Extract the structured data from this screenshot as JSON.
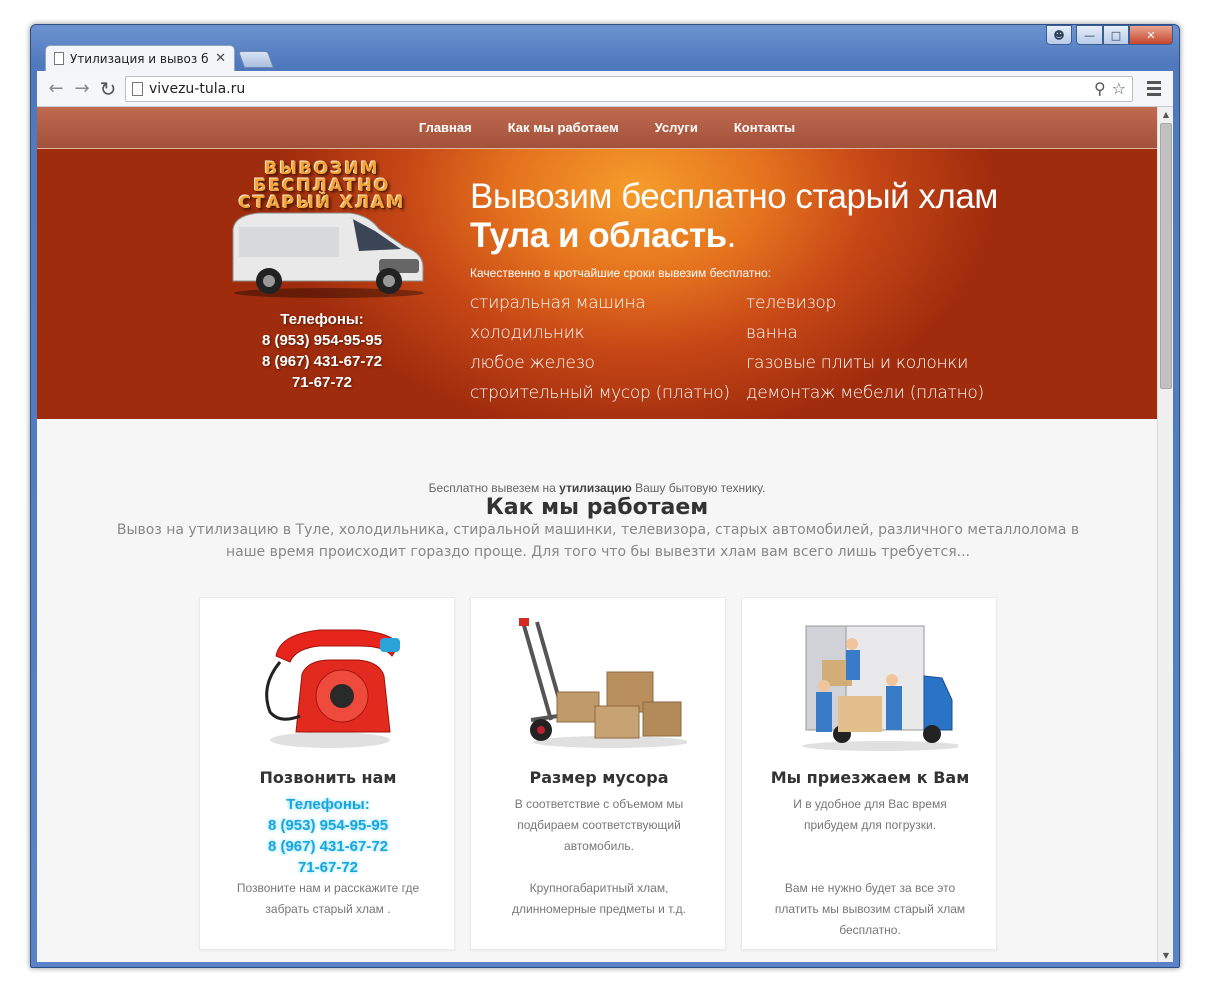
{
  "browser": {
    "tab_title": "Утилизация и вывоз быто",
    "url": "vivezu-tula.ru"
  },
  "nav": {
    "items": [
      "Главная",
      "Как мы работаем",
      "Услуги",
      "Контакты"
    ]
  },
  "hero": {
    "logo_lines": [
      "ВЫВОЗИМ",
      "БЕСПЛАТНО",
      "СТАРЫЙ ХЛАМ"
    ],
    "phones_label": "Телефоны:",
    "phones": [
      "8 (953) 954-95-95",
      "8 (967) 431-67-72",
      "71-67-72"
    ],
    "title_part1": "Вывозим бесплатно старый хлам ",
    "title_bold": "Тула и область",
    "title_end": ".",
    "subtitle": "Качественно в кротчайшие сроки вывезим бесплатно:",
    "items": [
      "стиральная машина",
      "телевизор",
      "холодильник",
      "ванна",
      "любое железо",
      "газовые плиты и колонки",
      "строительный мусор (платно)",
      "демонтаж мебели (платно)"
    ]
  },
  "section": {
    "pre_text_1": "Бесплатно вывезем на ",
    "pre_text_bold": "утилизацию",
    "pre_text_2": " Вашу бытовую технику.",
    "title": "Как мы работаем",
    "description": "Вывоз на утилизацию в Туле, холодильника, стиральной машинки, телевизора, старых автомобилей, различного металлолома в наше время происходит гораздо проще. Для того что бы вывезти хлам вам всего лишь требуется..."
  },
  "cards": [
    {
      "title": "Позвонить нам",
      "phones_label": "Телефоны:",
      "phones": [
        "8 (953) 954-95-95",
        "8 (967) 431-67-72",
        "71-67-72"
      ],
      "text": "Позвоните нам и расскажите где забрать старый хлам ."
    },
    {
      "title": "Размер мусора",
      "text": "В соответствие с объемом мы подбираем соответствующий автомобиль.",
      "text2": "Крупногабаритный хлам, длинномерные предметы и т.д."
    },
    {
      "title": "Мы приезжаем к Вам",
      "text": "И в удобное для Вас время прибудем для погрузки.",
      "text2": "Вам не нужно будет за все это платить мы вывозим старый хлам бесплатно."
    }
  ]
}
